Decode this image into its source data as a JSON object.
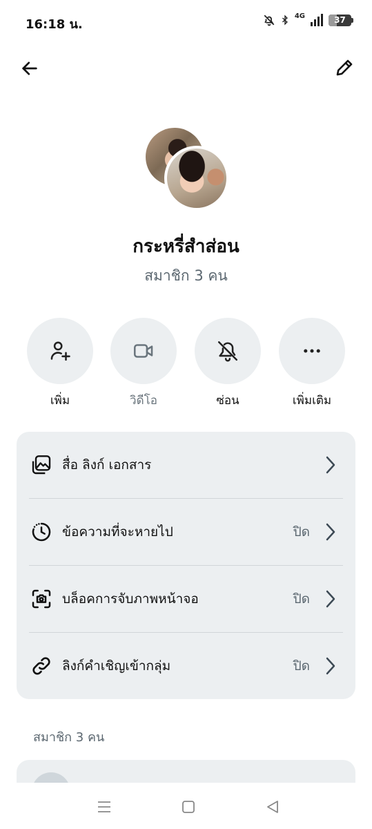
{
  "status_bar": {
    "time": "16:18 น.",
    "network": "4G",
    "battery": "37",
    "battery_level": 0.37
  },
  "header": {
    "back_icon": "arrow-left-icon",
    "edit_icon": "pencil-icon"
  },
  "group": {
    "name": "กระหรี่สำส่อน",
    "member_count": "สมาชิก 3 คน"
  },
  "actions": [
    {
      "label": "เพิ่ม",
      "icon": "add-person-icon",
      "enabled": true
    },
    {
      "label": "วิดีโอ",
      "icon": "video-camera-icon",
      "enabled": false
    },
    {
      "label": "ซ่อน",
      "icon": "bell-off-icon",
      "enabled": true
    },
    {
      "label": "เพิ่มเติม",
      "icon": "more-dots-icon",
      "enabled": true
    }
  ],
  "settings": [
    {
      "label": "สื่อ ลิงก์ เอกสาร",
      "value": "",
      "icon": "media-gallery-icon"
    },
    {
      "label": "ข้อความที่จะหายไป",
      "value": "ปิด",
      "icon": "timer-icon"
    },
    {
      "label": "บล็อคการจับภาพหน้าจอ",
      "value": "ปิด",
      "icon": "screenshot-camera-icon"
    },
    {
      "label": "ลิงก์คำเชิญเข้ากลุ่ม",
      "value": "ปิด",
      "icon": "link-icon"
    }
  ],
  "members_section": {
    "title": "สมาชิก 3 คน"
  },
  "colors": {
    "card_bg": "#eceff1",
    "muted_text": "#5b6770",
    "primary_text": "#111111"
  }
}
